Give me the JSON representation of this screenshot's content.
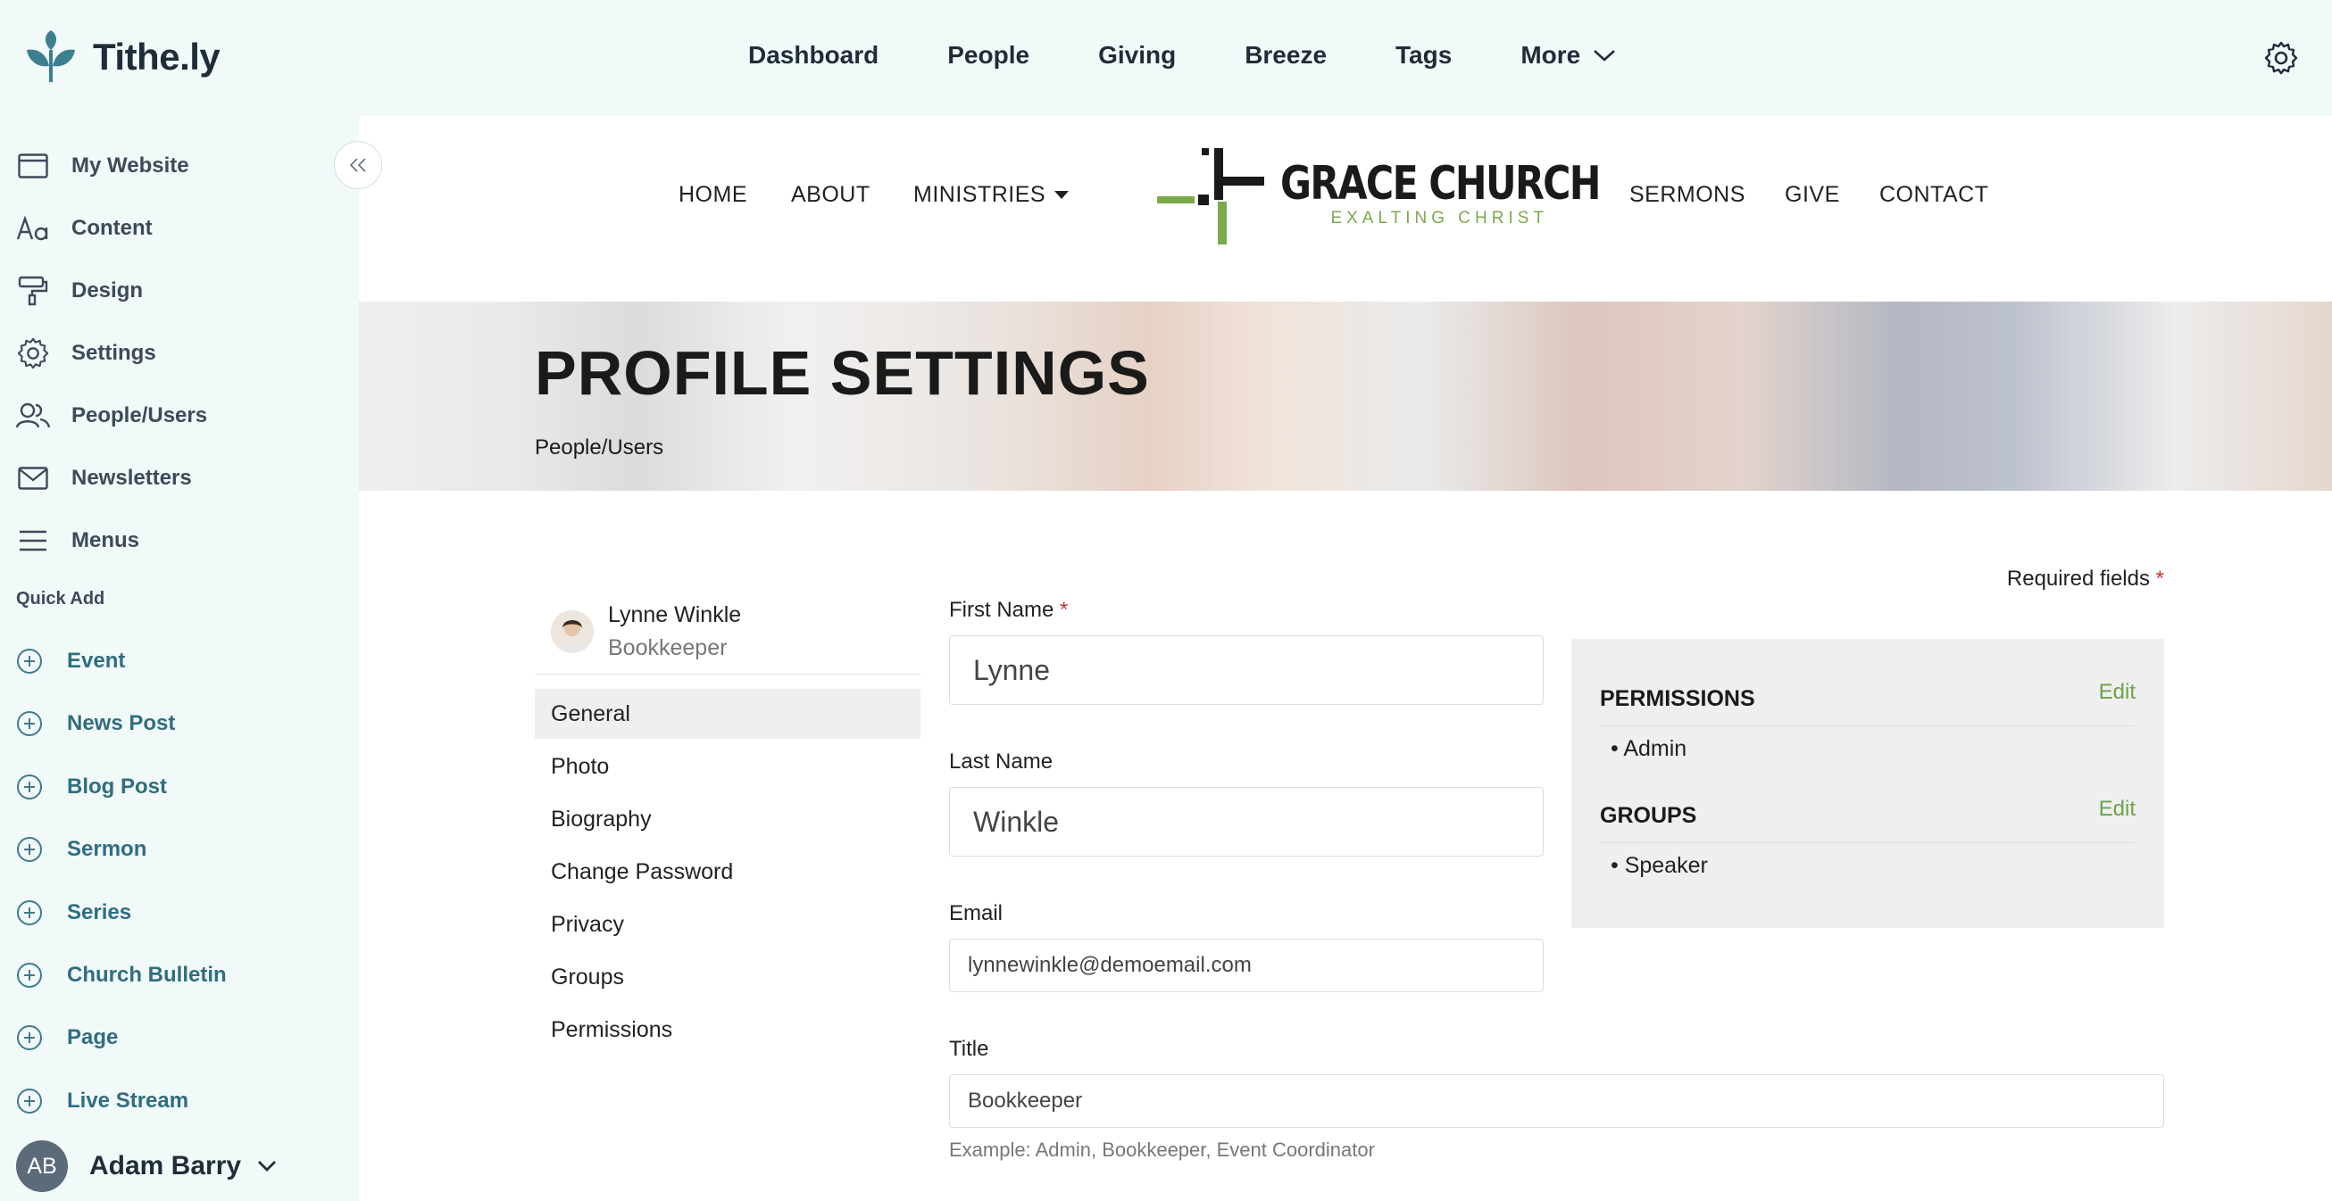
{
  "app": {
    "logo_text": "Tithe.ly",
    "nav": [
      "Dashboard",
      "People",
      "Giving",
      "Breeze",
      "Tags",
      "More"
    ]
  },
  "sidebar": {
    "items": [
      "My Website",
      "Content",
      "Design",
      "Settings",
      "People/Users",
      "Newsletters",
      "Menus"
    ],
    "quick_add_label": "Quick Add",
    "quick_add": [
      "Event",
      "News Post",
      "Blog Post",
      "Sermon",
      "Series",
      "Church Bulletin",
      "Page",
      "Live Stream"
    ],
    "user": {
      "initials": "AB",
      "name": "Adam Barry"
    }
  },
  "site": {
    "nav_left": [
      "HOME",
      "ABOUT",
      "MINISTRIES"
    ],
    "nav_right": [
      "SERMONS",
      "GIVE",
      "CONTACT"
    ],
    "church_name": "GRACE CHURCH",
    "church_tagline": "EXALTING CHRIST",
    "hero_title": "PROFILE SETTINGS",
    "hero_breadcrumb": "People/Users"
  },
  "profile": {
    "name": "Lynne Winkle",
    "role": "Bookkeeper",
    "menu": [
      "General",
      "Photo",
      "Biography",
      "Change Password",
      "Privacy",
      "Groups",
      "Permissions"
    ],
    "active_menu": "General"
  },
  "form": {
    "required_text": "Required fields",
    "required_star": "*",
    "first_name_label": "First Name",
    "first_name_value": "Lynne",
    "last_name_label": "Last Name",
    "last_name_value": "Winkle",
    "email_label": "Email",
    "email_value": "lynnewinkle@demoemail.com",
    "title_label": "Title",
    "title_value": "Bookkeeper",
    "title_hint": "Example: Admin, Bookkeeper, Event Coordinator"
  },
  "panel": {
    "permissions_heading": "PERMISSIONS",
    "permissions_edit": "Edit",
    "permissions_items": [
      "Admin"
    ],
    "groups_heading": "GROUPS",
    "groups_edit": "Edit",
    "groups_items": [
      "Speaker"
    ]
  },
  "colors": {
    "accent_green": "#6aa24a",
    "sidebar_bg": "#f2f9f9",
    "quick_add_text": "#2f6e80"
  }
}
